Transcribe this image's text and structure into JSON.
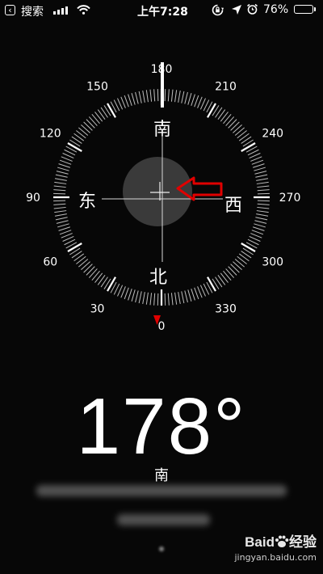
{
  "status_bar": {
    "back_label": "搜索",
    "time": "上午7:28",
    "battery_text": "76%",
    "battery_level": 0.76,
    "icons": [
      "back-chevron-icon",
      "cellular-signal-icon",
      "wifi-icon",
      "rotation-lock-icon",
      "location-arrow-icon",
      "alarm-icon",
      "battery-icon"
    ]
  },
  "compass": {
    "degree_labels": [
      "180",
      "210",
      "240",
      "270",
      "300",
      "330",
      "0",
      "30",
      "60",
      "90",
      "120",
      "150"
    ],
    "cardinals": {
      "top": "南",
      "right": "西",
      "bottom": "北",
      "left": "东"
    },
    "needle_color": "#ffffff",
    "true_north_marker_color": "#e00000",
    "annotation_arrow_color": "#e00000"
  },
  "heading": {
    "degrees": "178",
    "degree_symbol": "°",
    "direction": "南"
  },
  "watermark": {
    "logo_text": "Baid",
    "logo_suffix": "经验",
    "url": "jingyan.baidu.com"
  }
}
